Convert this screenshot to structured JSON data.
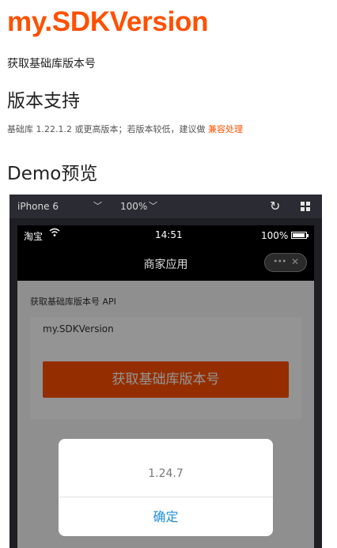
{
  "doc": {
    "title": "my.SDKVersion",
    "subtitle": "获取基础库版本号",
    "section_support": "版本支持",
    "support_text": "基础库 1.22.1.2 或更高版本；若版本较低，建议做 ",
    "support_link": "兼容处理",
    "section_demo": "Demo预览"
  },
  "simulator": {
    "device": "iPhone 6",
    "zoom": "100%",
    "icons": {
      "device_dropdown": "chevron-down-icon",
      "zoom_dropdown": "chevron-down-icon",
      "refresh": "refresh-icon",
      "layout": "grid-icon"
    }
  },
  "phone": {
    "status": {
      "carrier": "淘宝",
      "time": "14:51",
      "battery": "100%"
    },
    "nav_title": "商家应用",
    "page": {
      "api_label": "获取基础库版本号 API",
      "method": "my.SDKVersion",
      "button": "获取基础库版本号"
    },
    "dialog": {
      "message": "1.24.7",
      "confirm": "确定"
    }
  },
  "colors": {
    "accent": "#ff5000",
    "link_blue": "#1e8fe0",
    "sim_bg": "#1e1e24"
  }
}
